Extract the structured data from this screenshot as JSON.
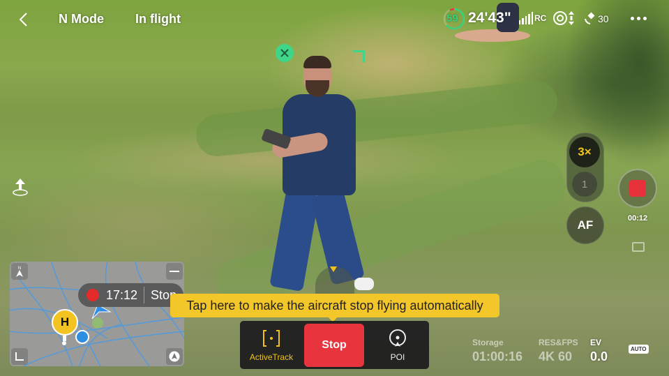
{
  "topbar": {
    "mode": "N Mode",
    "flight_status": "In flight",
    "battery_percent": "59",
    "flight_time_remaining": "24'43\"",
    "rc_label": "RC",
    "gps_satellites": "30",
    "icons": {
      "back": "chevron-left-icon",
      "signal": "signal-bars-icon",
      "obstacle": "obstacle-avoidance-icon",
      "gps": "satellite-icon",
      "more": "more-dots-icon"
    }
  },
  "camera": {
    "zoom_selected": "3×",
    "zoom_other": "1",
    "af_label": "AF",
    "record_time": "00:12",
    "storage_label": "Storage",
    "storage_value": "01:00:16",
    "res_label": "RES&FPS",
    "res_value": "4K 60",
    "ev_label": "EV",
    "ev_value": "0.0",
    "auto_badge": "AUTO"
  },
  "map": {
    "recording_time": "17:12",
    "recording_stop": "Stop",
    "home_label": "H",
    "north_label": "N"
  },
  "tooltip": {
    "text": "Tap here to make the aircraft stop flying automatically"
  },
  "actions": {
    "activetrack": "ActiveTrack",
    "stop": "Stop",
    "poi": "POI"
  },
  "colors": {
    "accent_yellow": "#f3c62a",
    "stop_red": "#e8343d",
    "track_green": "#3fd68a",
    "battery_green": "#36d07c"
  }
}
